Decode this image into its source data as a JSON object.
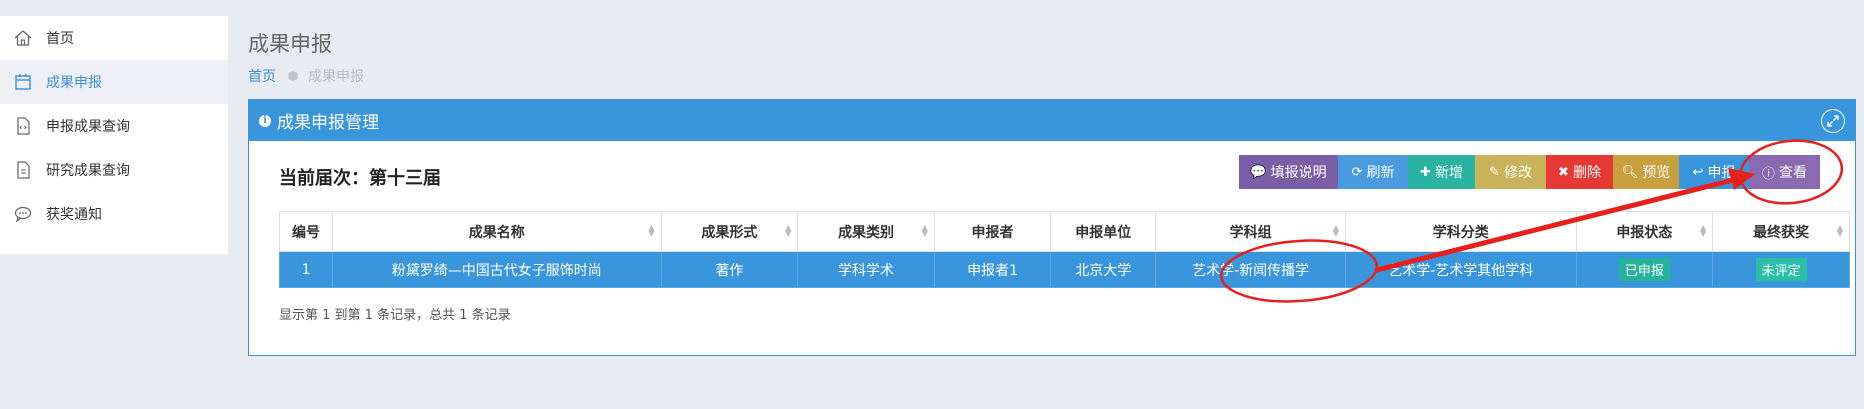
{
  "sidebar": {
    "items": [
      {
        "label": "首页",
        "icon": "home-icon"
      },
      {
        "label": "成果申报",
        "icon": "calendar-icon",
        "active": true
      },
      {
        "label": "申报成果查询",
        "icon": "code-file-icon"
      },
      {
        "label": "研究成果查询",
        "icon": "document-icon"
      },
      {
        "label": "获奖通知",
        "icon": "chat-icon"
      }
    ]
  },
  "page": {
    "title": "成果申报",
    "breadcrumb": {
      "home": "首页",
      "current": "成果申报"
    }
  },
  "panel": {
    "title": "成果申报管理",
    "session_label": "当前届次：第十三届"
  },
  "toolbar": {
    "help": "填报说明",
    "refresh": "刷新",
    "add": "新增",
    "edit": "修改",
    "delete": "删除",
    "preview": "预览",
    "submit": "申报",
    "view": "查看"
  },
  "table": {
    "headers": [
      "编号",
      "成果名称",
      "成果形式",
      "成果类别",
      "申报者",
      "申报单位",
      "学科组",
      "学科分类",
      "申报状态",
      "最终获奖"
    ],
    "rows": [
      {
        "id": "1",
        "name": "粉黛罗绮—中国古代女子服饰时尚",
        "form": "著作",
        "category": "学科学术",
        "applicant": "申报者1",
        "unit": "北京大学",
        "group": "艺术学-新闻传播学",
        "classification": "艺术学-艺术学其他学科",
        "status": "已申报",
        "award": "未评定"
      }
    ],
    "record_info": "显示第 1 到第 1 条记录，总共 1 条记录"
  },
  "colors": {
    "accent": "#3a96dc",
    "annotation": "#e8201c"
  }
}
